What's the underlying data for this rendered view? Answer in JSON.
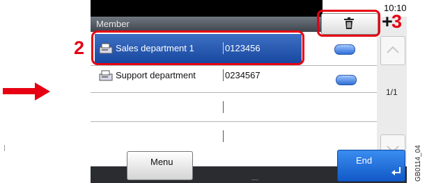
{
  "header": {
    "clock": "10:10",
    "title": "Member"
  },
  "list": {
    "rows": [
      {
        "name": "Sales department 1",
        "number": "0123456"
      },
      {
        "name": "Support department",
        "number": "0234567"
      },
      {
        "name": "",
        "number": ""
      },
      {
        "name": "",
        "number": ""
      }
    ]
  },
  "pager": {
    "page": "1/1"
  },
  "footer": {
    "menu_label": "Menu",
    "end_label": "End"
  },
  "annotations": {
    "step_2": "2",
    "step_3": "3",
    "plus": "+"
  },
  "figure_code": "GB0114_04",
  "colors": {
    "accent_red": "#e60012",
    "selected_row": "#1f4fa6",
    "end_button": "#1f6fe0"
  },
  "icons": {
    "delete": "trash-icon",
    "row": "fax-icon",
    "end": "enter-icon"
  }
}
